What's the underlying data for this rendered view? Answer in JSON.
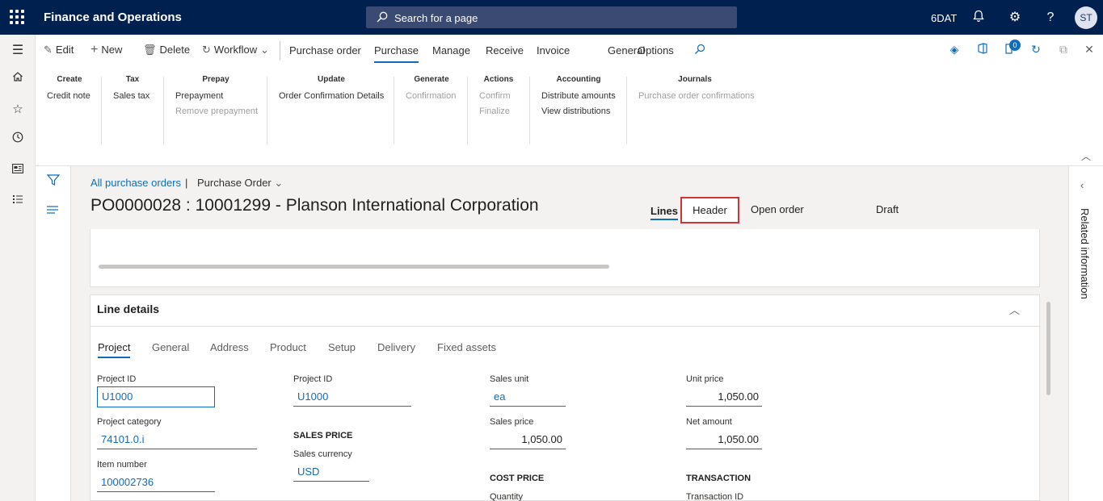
{
  "topbar": {
    "app_title": "Finance and Operations",
    "search_placeholder": "Search for a page",
    "company": "6DAT",
    "avatar_initials": "ST"
  },
  "actions": {
    "edit": "Edit",
    "new": "New",
    "delete": "Delete",
    "workflow": "Workflow",
    "tabs": [
      "Purchase order",
      "Purchase",
      "Manage",
      "Receive",
      "Invoice",
      "General",
      "Options"
    ],
    "active_tab": "Purchase",
    "notification_count": "0"
  },
  "groups": {
    "create": {
      "title": "Create",
      "items": [
        "Credit note"
      ]
    },
    "tax": {
      "title": "Tax",
      "items": [
        "Sales tax"
      ]
    },
    "prepay": {
      "title": "Prepay",
      "items": [
        "Prepayment",
        "Remove prepayment"
      ]
    },
    "update": {
      "title": "Update",
      "items": [
        "Order Confirmation Details"
      ]
    },
    "generate": {
      "title": "Generate",
      "items": [
        "Confirmation"
      ]
    },
    "actions": {
      "title": "Actions",
      "items": [
        "Confirm",
        "Finalize"
      ]
    },
    "accounting": {
      "title": "Accounting",
      "items": [
        "Distribute amounts",
        "View distributions"
      ]
    },
    "journals": {
      "title": "Journals",
      "items": [
        "Purchase order confirmations"
      ]
    }
  },
  "breadcrumb": {
    "link": "All purchase orders",
    "separator": "|",
    "current": "Purchase Order"
  },
  "page": {
    "title": "PO0000028 : 10001299 - Planson International Corporation",
    "view_lines": "Lines",
    "view_header": "Header",
    "status_open": "Open order",
    "status_draft": "Draft"
  },
  "line_details": {
    "title": "Line details",
    "tabs": [
      "Project",
      "General",
      "Address",
      "Product",
      "Setup",
      "Delivery",
      "Fixed assets"
    ],
    "fields": {
      "project_id_label": "Project ID",
      "project_id_value": "U1000",
      "project_category_label": "Project category",
      "project_category_value": "74101.0.i",
      "item_number_label": "Item number",
      "item_number_value": "100002736",
      "project_id2_label": "Project ID",
      "project_id2_value": "U1000",
      "sales_price_section": "SALES PRICE",
      "sales_currency_label": "Sales currency",
      "sales_currency_value": "USD",
      "sales_unit_label": "Sales unit",
      "sales_unit_value": "ea",
      "sales_price_label": "Sales price",
      "sales_price_value": "1,050.00",
      "cost_price_section": "COST PRICE",
      "quantity_label": "Quantity",
      "unit_price_label": "Unit price",
      "unit_price_value": "1,050.00",
      "net_amount_label": "Net amount",
      "net_amount_value": "1,050.00",
      "transaction_section": "TRANSACTION",
      "transaction_id_label": "Transaction ID"
    }
  },
  "related": {
    "label": "Related information"
  }
}
